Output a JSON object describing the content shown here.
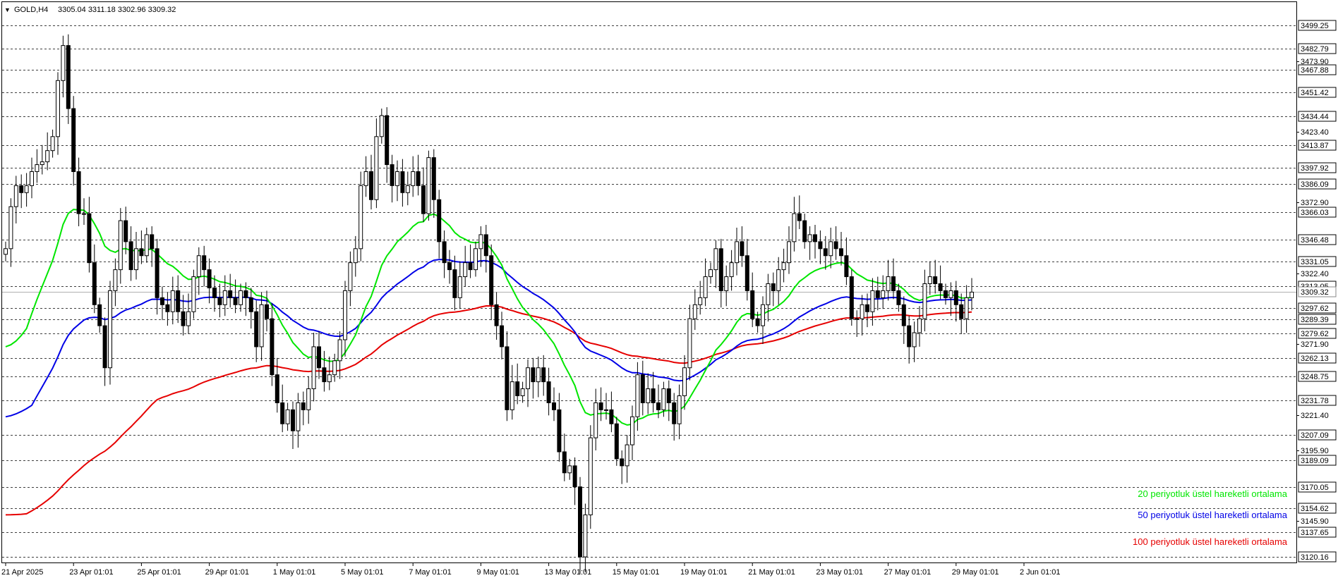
{
  "header": {
    "symbol": "GOLD,H4",
    "ohlc": "3305.04 3311.18 3302.96 3309.32",
    "menu_glyph": "▼"
  },
  "colors": {
    "background": "#ffffff",
    "grid": "#000000",
    "bull_body": "#ffffff",
    "bear_body": "#000000",
    "ema20": "#00e600",
    "ema50": "#0000e6",
    "ema100": "#e60000"
  },
  "chart_data": {
    "type": "candlestick",
    "title": "GOLD,H4",
    "ylim": [
      3116,
      3516
    ],
    "grid": true,
    "legend_placement": "bottom-right",
    "price_levels": [
      3499.25,
      3482.79,
      3467.88,
      3451.42,
      3434.44,
      3413.87,
      3397.92,
      3386.09,
      3366.03,
      3346.48,
      3331.05,
      3313.05,
      3297.62,
      3289.39,
      3279.62,
      3262.13,
      3248.75,
      3231.78,
      3207.09,
      3189.09,
      3170.05,
      3154.62,
      3137.65,
      3120.16
    ],
    "y_tick_labels": [
      3473.9,
      3423.4,
      3372.9,
      3322.4,
      3271.9,
      3221.4,
      3195.9,
      3145.9
    ],
    "current_price": 3309.32,
    "x_tick_labels": [
      {
        "i": 0,
        "label": "21 Apr 2025"
      },
      {
        "i": 13,
        "label": "23 Apr 01:01"
      },
      {
        "i": 26,
        "label": "25 Apr 01:01"
      },
      {
        "i": 39,
        "label": "29 Apr 01:01"
      },
      {
        "i": 52,
        "label": "1 May 01:01"
      },
      {
        "i": 65,
        "label": "5 May 01:01"
      },
      {
        "i": 78,
        "label": "7 May 01:01"
      },
      {
        "i": 91,
        "label": "9 May 01:01"
      },
      {
        "i": 104,
        "label": "13 May 01:01"
      },
      {
        "i": 117,
        "label": "15 May 01:01"
      },
      {
        "i": 130,
        "label": "19 May 01:01"
      },
      {
        "i": 143,
        "label": "21 May 01:01"
      },
      {
        "i": 156,
        "label": "23 May 01:01"
      },
      {
        "i": 169,
        "label": "27 May 01:01"
      },
      {
        "i": 182,
        "label": "29 May 01:01"
      },
      {
        "i": 195,
        "label": "2 Jun 01:01"
      }
    ],
    "series": [
      {
        "name": "20 periyotluk üstel hareketli ortalama",
        "color": "#00e600"
      },
      {
        "name": "50 periyotluk üstel hareketli ortalama",
        "color": "#0000e6"
      },
      {
        "name": "100 periyotluk üstel hareketli ortalama",
        "color": "#e60000"
      }
    ],
    "close": [
      3340,
      3370,
      3385,
      3380,
      3385,
      3395,
      3400,
      3402,
      3410,
      3420,
      3460,
      3485,
      3440,
      3395,
      3365,
      3365,
      3330,
      3300,
      3285,
      3255,
      3310,
      3325,
      3360,
      3345,
      3325,
      3340,
      3335,
      3350,
      3340,
      3305,
      3300,
      3295,
      3310,
      3295,
      3285,
      3295,
      3320,
      3335,
      3325,
      3312,
      3305,
      3300,
      3310,
      3305,
      3300,
      3310,
      3305,
      3295,
      3270,
      3300,
      3290,
      3250,
      3230,
      3215,
      3225,
      3210,
      3230,
      3225,
      3240,
      3270,
      3255,
      3245,
      3250,
      3260,
      3275,
      3310,
      3330,
      3340,
      3385,
      3395,
      3375,
      3420,
      3435,
      3400,
      3385,
      3395,
      3380,
      3385,
      3395,
      3385,
      3365,
      3405,
      3375,
      3345,
      3330,
      3325,
      3305,
      3320,
      3330,
      3325,
      3340,
      3350,
      3335,
      3300,
      3285,
      3270,
      3225,
      3245,
      3235,
      3240,
      3255,
      3245,
      3255,
      3245,
      3230,
      3225,
      3195,
      3180,
      3185,
      3170,
      3120,
      3150,
      3205,
      3230,
      3225,
      3225,
      3215,
      3190,
      3185,
      3200,
      3220,
      3250,
      3230,
      3240,
      3230,
      3225,
      3240,
      3230,
      3215,
      3235,
      3255,
      3290,
      3300,
      3305,
      3320,
      3325,
      3340,
      3310,
      3320,
      3330,
      3345,
      3335,
      3310,
      3290,
      3285,
      3300,
      3315,
      3310,
      3325,
      3330,
      3345,
      3365,
      3360,
      3345,
      3350,
      3345,
      3340,
      3335,
      3345,
      3340,
      3335,
      3320,
      3290,
      3290,
      3300,
      3295,
      3310,
      3305,
      3310,
      3320,
      3310,
      3300,
      3285,
      3270,
      3280,
      3290,
      3315,
      3320,
      3315,
      3310,
      3305,
      3310,
      3300,
      3290,
      3305,
      3309
    ],
    "ema20_legend": "20 periyotluk üstel hareketli ortalama",
    "ema50_legend": "50 periyotluk üstel hareketli ortalama",
    "ema100_legend": "100 periyotluk üstel hareketli ortalama"
  }
}
